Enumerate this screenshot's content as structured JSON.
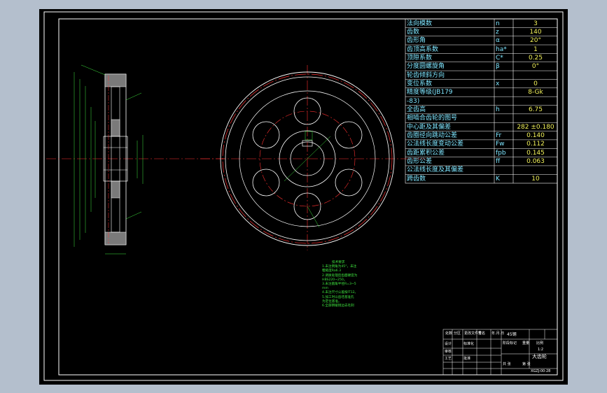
{
  "params": [
    {
      "label": "法向模数",
      "symbol": "n",
      "value": "3"
    },
    {
      "label": "齿数",
      "symbol": "z",
      "value": "140"
    },
    {
      "label": "齿形角",
      "symbol": "α",
      "value": "20°"
    },
    {
      "label": "齿顶高系数",
      "symbol": "ha*",
      "value": "1"
    },
    {
      "label": "顶隙系数",
      "symbol": "C*",
      "value": "0.25"
    },
    {
      "label": "分度圆螺旋角",
      "symbol": "β",
      "value": "0°"
    },
    {
      "label": "轮齿倾斜方向",
      "symbol": "",
      "value": ""
    },
    {
      "label": "变位系数",
      "symbol": "x",
      "value": "0"
    },
    {
      "label": "精度等级(JB179",
      "symbol": "",
      "value": "8-Gk"
    },
    {
      "label": "-83)",
      "symbol": "",
      "value": ""
    },
    {
      "label": "全齿高",
      "symbol": "h",
      "value": "6.75"
    },
    {
      "label": "相啮合齿轮的图号",
      "symbol": "",
      "value": ""
    },
    {
      "label": "中心距及其偏差",
      "symbol": "",
      "value": "282 ±0.180"
    },
    {
      "label": "齿圈径向跳动公差",
      "symbol": "Fr",
      "value": "0.140"
    },
    {
      "label": "公法线长度变动公差",
      "symbol": "Fw",
      "value": "0.112"
    },
    {
      "label": "齿距累积公差",
      "symbol": "fpb",
      "value": "0.145"
    },
    {
      "label": "齿形公差",
      "symbol": "ff",
      "value": "0.063"
    },
    {
      "label": "公法线长度及其偏差",
      "symbol": "",
      "value": ""
    },
    {
      "label": "跨齿数",
      "symbol": "K",
      "value": "10"
    }
  ],
  "notes": {
    "title": "技术要求",
    "lines": [
      "1.未注倒角为45°，未注",
      "  粗糙度Ra6.3",
      "2.调质处理后齿面硬度为",
      "  HBS220~250。",
      "3.未注圆角半径R=3~5",
      "  mm",
      "4.未注尺寸公差按IT12。",
      "5.加工时以齿坯基准孔",
      "  为定位基准。",
      "6.全部倒棱锐边去毛刺"
    ]
  },
  "title_block": {
    "labels": [
      "处数",
      "分区",
      "更改文件号",
      "签名",
      "年.月.日",
      "设计",
      "标准化",
      "审核",
      "工艺",
      "批准",
      "阶段标记",
      "重量",
      "比例",
      "共 张",
      "第 张"
    ],
    "part_name": "大齿轮",
    "material": "45钢",
    "drawing_no": "XGZJ-00-28",
    "scale": "1:2"
  },
  "colors": {
    "background": "#000000",
    "sheet_border": "#ffffff",
    "outline": "#ffffff",
    "center_line": "#ff3030",
    "dimension": "#3fe63f",
    "table_text": "#7fe6ff",
    "table_value": "#f2f25a"
  }
}
